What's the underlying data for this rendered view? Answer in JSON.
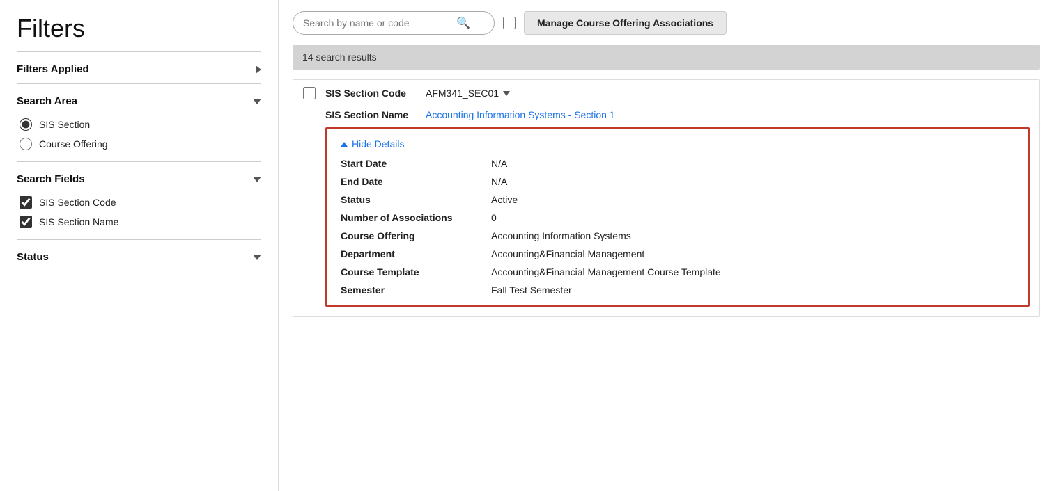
{
  "sidebar": {
    "title": "Filters",
    "filters_applied": {
      "label": "Filters Applied",
      "icon": "chevron-right"
    },
    "search_area": {
      "label": "Search Area",
      "icon": "chevron-down",
      "options": [
        {
          "id": "sis-section",
          "label": "SIS Section",
          "checked": true
        },
        {
          "id": "course-offering",
          "label": "Course Offering",
          "checked": false
        }
      ]
    },
    "search_fields": {
      "label": "Search Fields",
      "icon": "chevron-down",
      "options": [
        {
          "id": "sis-section-code",
          "label": "SIS Section Code",
          "checked": true
        },
        {
          "id": "sis-section-name",
          "label": "SIS Section Name",
          "checked": true
        }
      ]
    },
    "status": {
      "label": "Status",
      "icon": "chevron-down"
    }
  },
  "main": {
    "search": {
      "placeholder": "Search by name or code"
    },
    "manage_btn_label": "Manage Course Offering Associations",
    "results_count": "14 search results",
    "result": {
      "sis_section_code_label": "SIS Section Code",
      "sis_section_code_value": "AFM341_SEC01",
      "sis_section_name_label": "SIS Section Name",
      "sis_section_name_value": "Accounting Information Systems - Section ",
      "sis_section_name_link": "1",
      "hide_details_label": "Hide Details",
      "details": {
        "start_date_label": "Start Date",
        "start_date_value": "N/A",
        "end_date_label": "End Date",
        "end_date_value": "N/A",
        "status_label": "Status",
        "status_value": "Active",
        "num_associations_label": "Number of Associations",
        "num_associations_value": "0",
        "course_offering_label": "Course Offering",
        "course_offering_value": "Accounting Information Systems",
        "department_label": "Department",
        "department_value": "Accounting&Financial Management",
        "course_template_label": "Course Template",
        "course_template_value": "Accounting&Financial Management Course Template",
        "semester_label": "Semester",
        "semester_value": "Fall Test Semester"
      }
    }
  }
}
